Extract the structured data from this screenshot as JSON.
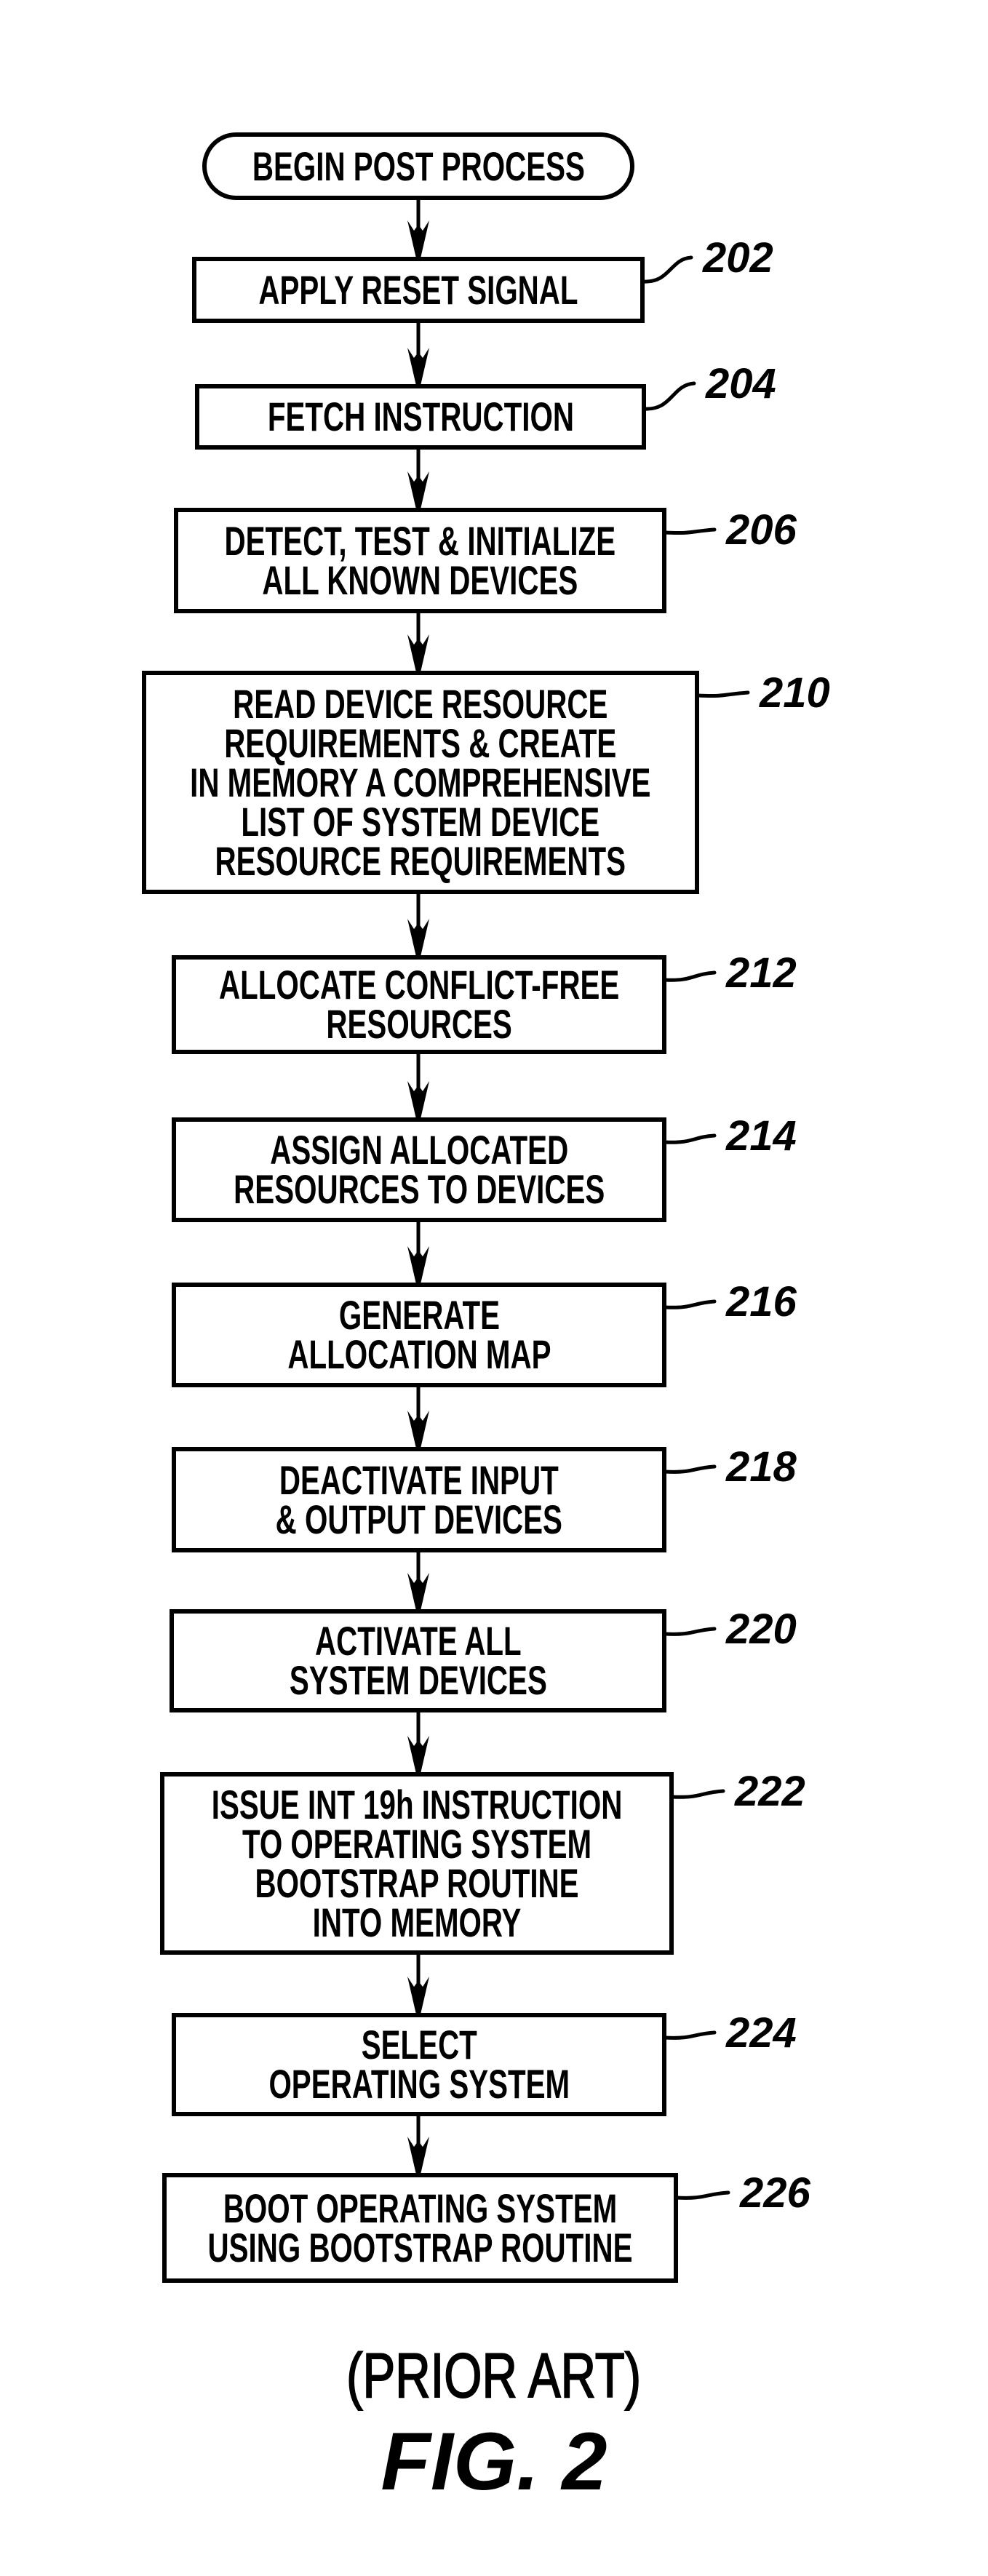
{
  "figure": {
    "caption_note": "(PRIOR ART)",
    "caption_title": "FIG. 2"
  },
  "flowchart": {
    "start": {
      "label": "BEGIN POST PROCESS",
      "shape": "terminal"
    },
    "steps": [
      {
        "ref": "202",
        "lines": [
          "APPLY RESET SIGNAL"
        ]
      },
      {
        "ref": "204",
        "lines": [
          "FETCH INSTRUCTION"
        ]
      },
      {
        "ref": "206",
        "lines": [
          "DETECT, TEST & INITIALIZE",
          "ALL KNOWN DEVICES"
        ]
      },
      {
        "ref": "210",
        "lines": [
          "READ DEVICE RESOURCE",
          "REQUIREMENTS & CREATE",
          "IN MEMORY A COMPREHENSIVE",
          "LIST OF SYSTEM DEVICE",
          "RESOURCE REQUIREMENTS"
        ]
      },
      {
        "ref": "212",
        "lines": [
          "ALLOCATE CONFLICT-FREE",
          "RESOURCES"
        ]
      },
      {
        "ref": "214",
        "lines": [
          "ASSIGN ALLOCATED",
          "RESOURCES TO DEVICES"
        ]
      },
      {
        "ref": "216",
        "lines": [
          "GENERATE",
          "ALLOCATION MAP"
        ]
      },
      {
        "ref": "218",
        "lines": [
          "DEACTIVATE INPUT",
          "& OUTPUT DEVICES"
        ]
      },
      {
        "ref": "220",
        "lines": [
          "ACTIVATE ALL",
          "SYSTEM DEVICES"
        ]
      },
      {
        "ref": "222",
        "lines": [
          "ISSUE INT 19h INSTRUCTION",
          "TO OPERATING SYSTEM",
          "BOOTSTRAP ROUTINE",
          "INTO MEMORY"
        ]
      },
      {
        "ref": "224",
        "lines": [
          "SELECT",
          "OPERATING SYSTEM"
        ]
      },
      {
        "ref": "226",
        "lines": [
          "BOOT OPERATING SYSTEM",
          "USING BOOTSTRAP ROUTINE"
        ]
      }
    ],
    "edges": [
      [
        "start",
        "202"
      ],
      [
        "202",
        "204"
      ],
      [
        "204",
        "206"
      ],
      [
        "206",
        "210"
      ],
      [
        "210",
        "212"
      ],
      [
        "212",
        "214"
      ],
      [
        "214",
        "216"
      ],
      [
        "216",
        "218"
      ],
      [
        "218",
        "220"
      ],
      [
        "220",
        "222"
      ],
      [
        "222",
        "224"
      ],
      [
        "224",
        "226"
      ]
    ]
  }
}
